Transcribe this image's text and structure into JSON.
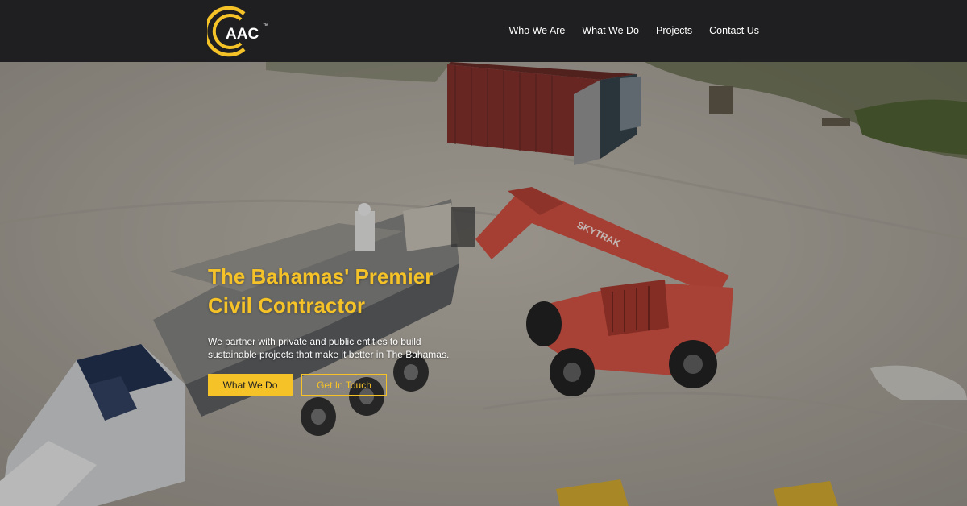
{
  "brand": {
    "logo_text": "AAC",
    "trademark": "™",
    "accent_color": "#f5c228",
    "nav_bg": "#1f1f21"
  },
  "nav": {
    "items": [
      {
        "label": "Who We Are"
      },
      {
        "label": "What We Do"
      },
      {
        "label": "Projects"
      },
      {
        "label": "Contact Us"
      }
    ]
  },
  "hero": {
    "title_line1": "The Bahamas' Premier",
    "title_line2": "Civil Contractor",
    "subtitle": "We partner with private and public entities to build sustainable projects that make it better in The Bahamas.",
    "primary_button": "What We Do",
    "secondary_button": "Get In Touch",
    "background_image": "aerial construction site with cement truck, telehandler and shipping container"
  }
}
